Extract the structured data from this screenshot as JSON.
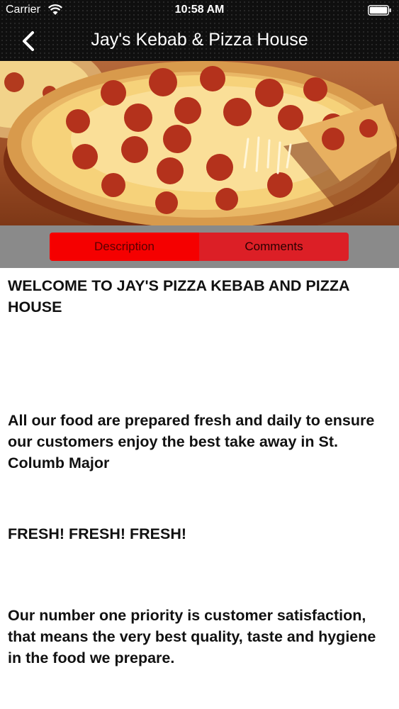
{
  "status_bar": {
    "carrier": "Carrier",
    "time": "10:58 AM"
  },
  "nav": {
    "title": "Jay's Kebab & Pizza House"
  },
  "tabs": {
    "description": "Description",
    "comments": "Comments"
  },
  "content": {
    "heading": "WELCOME TO JAY'S PIZZA KEBAB AND PIZZA HOUSE",
    "fresh": "All our food are prepared fresh and daily to ensure our customers enjoy the best take away in St. Columb Major",
    "slogan": "FRESH! FRESH! FRESH!",
    "priority": "Our number one priority is customer satisfaction, that means the very best quality, taste and hygiene in the food we prepare."
  },
  "colors": {
    "tab_active": "#f50000",
    "tab_inactive": "#dc1f26",
    "tab_strip": "#8a8a8a",
    "header": "#0f0f0f"
  }
}
